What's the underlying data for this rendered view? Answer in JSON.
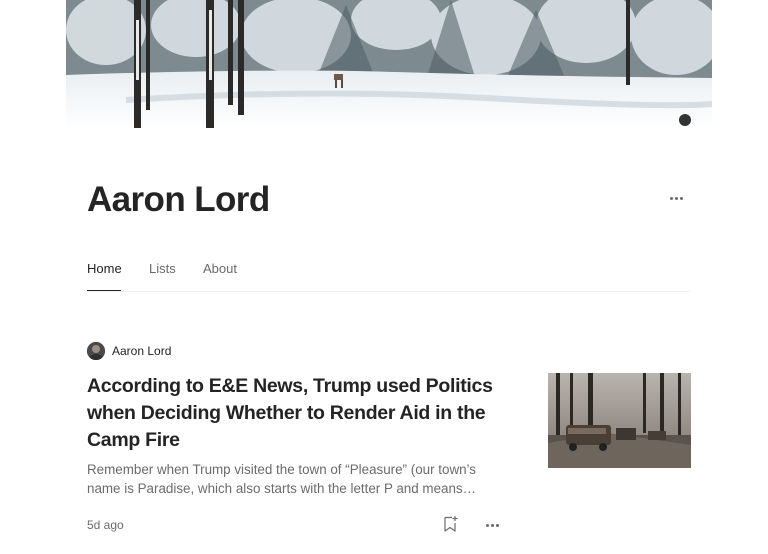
{
  "profile": {
    "name": "Aaron Lord"
  },
  "tabs": [
    {
      "label": "Home",
      "active": true
    },
    {
      "label": "Lists",
      "active": false
    },
    {
      "label": "About",
      "active": false
    }
  ],
  "post": {
    "author": "Aaron Lord",
    "title": "According to E&E News, Trump used Politics when Deciding Whether to Render Aid in the Camp Fire",
    "excerpt": "Remember when Trump visited the town of “Pleasure” (our town’s name is Paradise, which also starts with the letter P and means…",
    "date": "5d ago"
  },
  "icons": {
    "more_profile": "more-horizontal-icon",
    "bookmark": "bookmark-add-icon",
    "more_post": "more-horizontal-icon"
  },
  "colors": {
    "text_primary": "#242424",
    "text_secondary": "#6b6b6b",
    "divider": "#f2f2f2"
  }
}
